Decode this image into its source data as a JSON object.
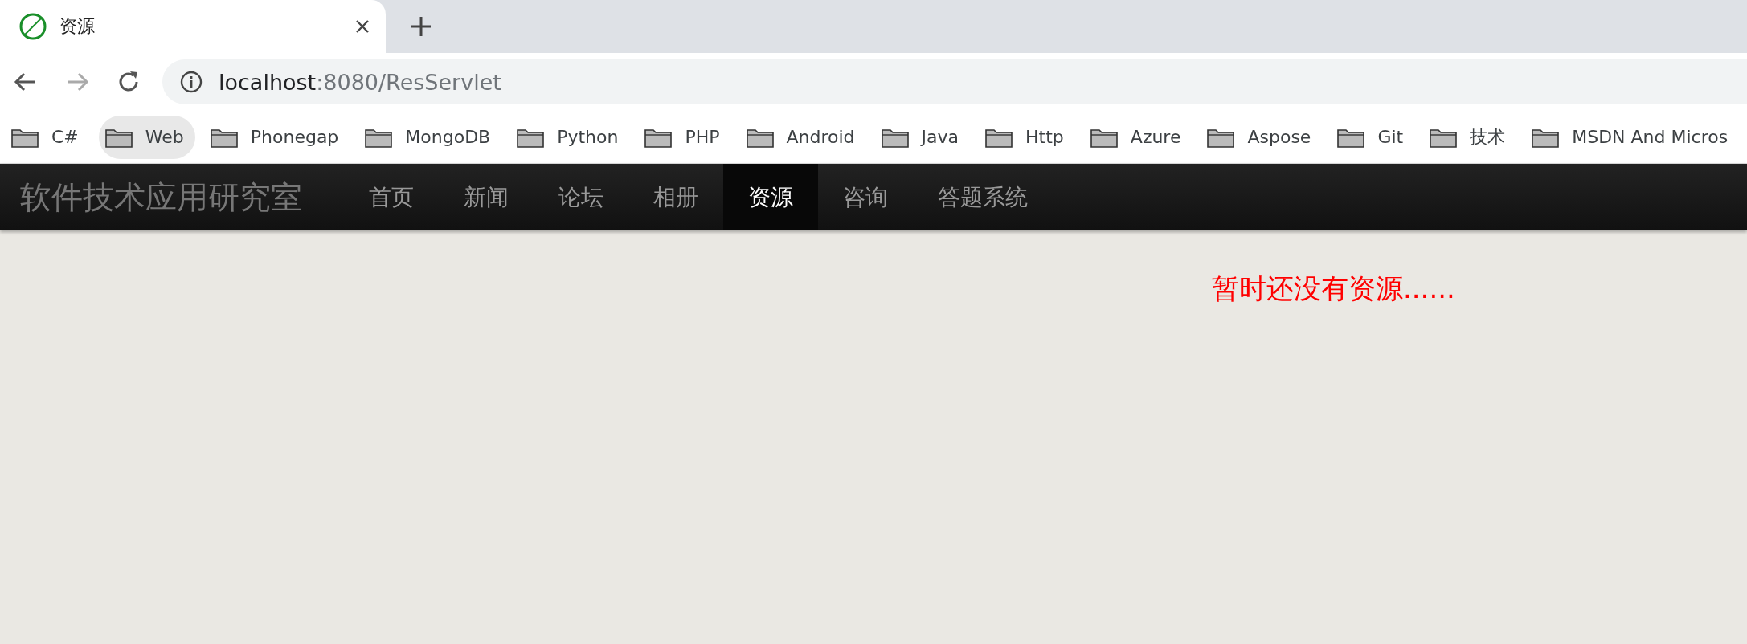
{
  "browser_tab": {
    "title": "资源"
  },
  "address_bar": {
    "host": "localhost",
    "path": ":8080/ResServlet"
  },
  "bookmarks": [
    {
      "label": "C#",
      "selected": false
    },
    {
      "label": "Web",
      "selected": true
    },
    {
      "label": "Phonegap",
      "selected": false
    },
    {
      "label": "MongoDB",
      "selected": false
    },
    {
      "label": "Python",
      "selected": false
    },
    {
      "label": "PHP",
      "selected": false
    },
    {
      "label": "Android",
      "selected": false
    },
    {
      "label": "Java",
      "selected": false
    },
    {
      "label": "Http",
      "selected": false
    },
    {
      "label": "Azure",
      "selected": false
    },
    {
      "label": "Aspose",
      "selected": false
    },
    {
      "label": "Git",
      "selected": false
    },
    {
      "label": "技术",
      "selected": false
    },
    {
      "label": "MSDN And Micros",
      "selected": false
    }
  ],
  "navbar": {
    "brand": "软件技术应用研究室",
    "items": [
      {
        "label": "首页",
        "selected": false
      },
      {
        "label": "新闻",
        "selected": false
      },
      {
        "label": "论坛",
        "selected": false
      },
      {
        "label": "相册",
        "selected": false
      },
      {
        "label": "资源",
        "selected": true
      },
      {
        "label": "咨询",
        "selected": false
      },
      {
        "label": "答题系统",
        "selected": false
      }
    ]
  },
  "message": "暂时还没有资源......"
}
